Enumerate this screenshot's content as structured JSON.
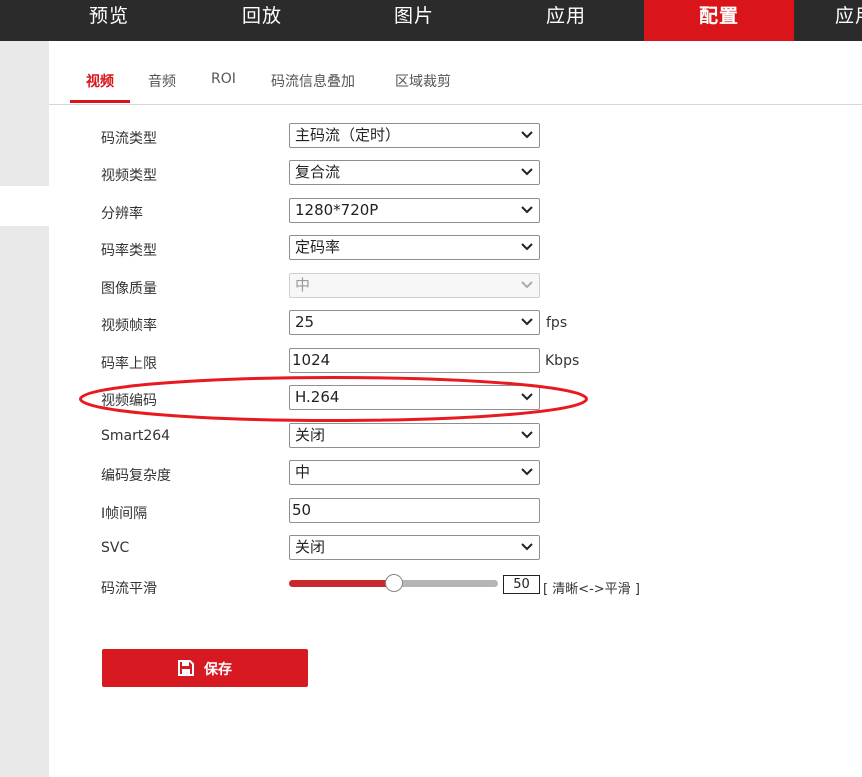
{
  "nav": {
    "items": [
      "预览",
      "回放",
      "图片",
      "应用",
      "配置",
      "应用"
    ],
    "active_index": 4
  },
  "tabs": {
    "items": [
      "视频",
      "音频",
      "ROI",
      "码流信息叠加",
      "区域裁剪"
    ],
    "active_index": 0
  },
  "form": {
    "stream_type": {
      "label": "码流类型",
      "value": "主码流（定时）"
    },
    "video_type": {
      "label": "视频类型",
      "value": "复合流"
    },
    "resolution": {
      "label": "分辨率",
      "value": "1280*720P"
    },
    "bitrate_type": {
      "label": "码率类型",
      "value": "定码率"
    },
    "image_quality": {
      "label": "图像质量",
      "value": "中"
    },
    "frame_rate": {
      "label": "视频帧率",
      "value": "25",
      "unit": "fps"
    },
    "max_bitrate": {
      "label": "码率上限",
      "value": "1024",
      "unit": "Kbps"
    },
    "video_encoding": {
      "label": "视频编码",
      "value": "H.264"
    },
    "smart264": {
      "label": "Smart264",
      "value": "关闭"
    },
    "encoding_complexity": {
      "label": "编码复杂度",
      "value": "中"
    },
    "i_frame_interval": {
      "label": "I帧间隔",
      "value": "50"
    },
    "svc": {
      "label": "SVC",
      "value": "关闭"
    },
    "smoothing": {
      "label": "码流平滑",
      "value": "50",
      "fraction": 0.5,
      "hint": "[ 清晰<->平滑 ]"
    }
  },
  "save": {
    "label": "保存"
  },
  "colors": {
    "accent": "#d9141b",
    "nav_bg": "#2b2b2b",
    "sidebar_bg": "#e9e9e9",
    "annotation": "#e8191f"
  }
}
